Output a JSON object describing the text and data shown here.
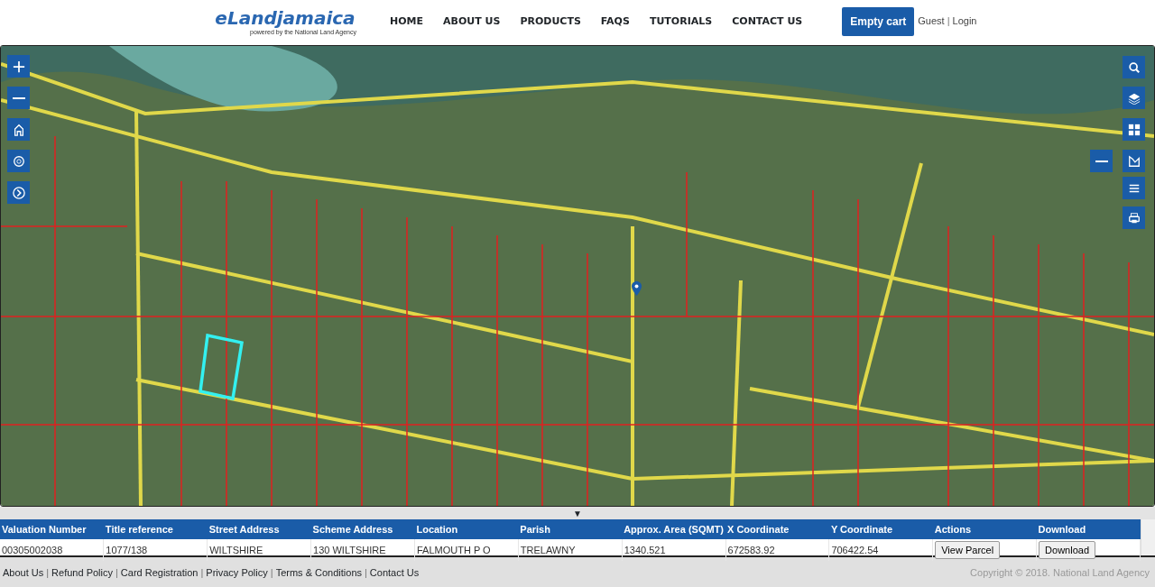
{
  "header": {
    "logo": "eLandjamaica",
    "tagline": "powered by the National Land Agency",
    "nav": [
      {
        "label": "HOME"
      },
      {
        "label": "ABOUT US"
      },
      {
        "label": "PRODUCTS"
      },
      {
        "label": "FAQS"
      },
      {
        "label": "TUTORIALS"
      },
      {
        "label": "CONTACT US"
      }
    ],
    "cart_button": "Empty cart",
    "user": "Guest",
    "separator": "|",
    "login": "Login"
  },
  "map": {
    "left_controls": [
      {
        "kind": "zoom-in"
      },
      {
        "kind": "zoom-out"
      },
      {
        "kind": "home"
      },
      {
        "kind": "locate"
      },
      {
        "kind": "next"
      }
    ],
    "right_controls": [
      {
        "kind": "search"
      },
      {
        "kind": "layers"
      },
      {
        "kind": "grid"
      },
      {
        "kind": "measure"
      },
      {
        "kind": "list"
      },
      {
        "kind": "print"
      }
    ],
    "side_button": {
      "kind": "minimize"
    }
  },
  "collapse_toggle": "▼",
  "table": {
    "columns": [
      "Valuation Number",
      "Title reference",
      "Street Address",
      "Scheme Address",
      "Location",
      "Parish",
      "Approx. Area (SQMT)",
      "X Coordinate",
      "Y Coordinate",
      "Actions",
      "Download"
    ],
    "rows": [
      {
        "cells": [
          "00305002038",
          "1077/138",
          "WILTSHIRE",
          "130 WILTSHIRE",
          "FALMOUTH P O",
          "TRELAWNY",
          "1340.521",
          "672583.92",
          "706422.54"
        ],
        "action": "View Parcel",
        "download": "Download"
      }
    ]
  },
  "footer": {
    "links": [
      "About Us",
      "Refund Policy",
      "Card Registration",
      "Privacy Policy",
      "Terms & Conditions",
      "Contact Us"
    ],
    "separator": "|",
    "copyright": "Copyright © 2018. National Land Agency"
  }
}
